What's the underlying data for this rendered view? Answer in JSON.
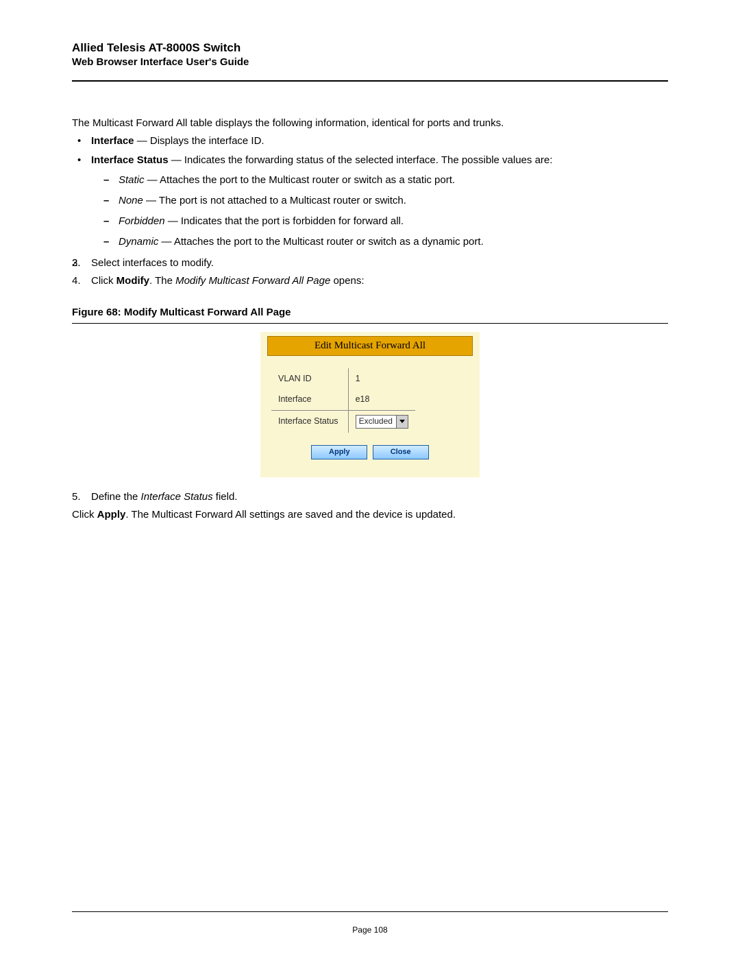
{
  "header": {
    "title": "Allied Telesis AT-8000S Switch",
    "subtitle": "Web Browser Interface User's Guide"
  },
  "content": {
    "intro": "The Multicast Forward All table displays the following information, identical for ports and trunks.",
    "bullets": {
      "interface_label": "Interface",
      "interface_desc": " — Displays the interface ID.",
      "ifstatus_label": "Interface Status",
      "ifstatus_desc": " — Indicates the forwarding status of the selected interface. The possible values are:",
      "sub": {
        "static_t": "Static",
        "static_d": " — Attaches the port to the Multicast router or switch as a static port.",
        "none_t": "None",
        "none_d": " — The port is not attached to a Multicast router or switch.",
        "forbidden_t": "Forbidden",
        "forbidden_d": " — Indicates that the port is forbidden for forward all.",
        "dynamic_t": "Dynamic",
        "dynamic_d": " — Attaches the port to the Multicast router or switch as a dynamic port."
      }
    },
    "steps1": {
      "n2": "2.",
      "t2": "",
      "n3": "3.",
      "t3": "Select interfaces to modify.",
      "n4": "4.",
      "t4_pre": "Click ",
      "t4_bold": "Modify",
      "t4_mid": ". The ",
      "t4_italic": "Modify Multicast Forward All Page",
      "t4_post": " opens:"
    },
    "figure_caption": "Figure 68:  Modify Multicast Forward All Page",
    "steps2": {
      "n5": "5.",
      "t5_pre": "Define the ",
      "t5_italic": "Interface Status",
      "t5_post": " field.",
      "apply_pre": "Click ",
      "apply_bold": "Apply",
      "apply_post": ". The Multicast Forward All settings are saved and the device is updated."
    }
  },
  "dialog": {
    "title": "Edit Multicast Forward All",
    "rows": {
      "vlan_label": "VLAN ID",
      "vlan_value": "1",
      "iface_label": "Interface",
      "iface_value": "e18",
      "status_label": "Interface Status",
      "status_value": "Excluded"
    },
    "buttons": {
      "apply": "Apply",
      "close": "Close"
    }
  },
  "footer": {
    "page_number": "Page 108"
  }
}
